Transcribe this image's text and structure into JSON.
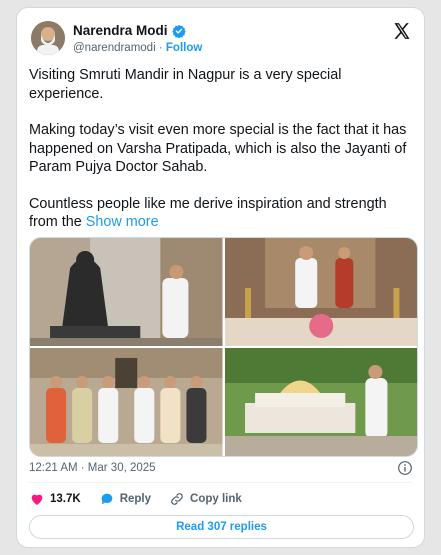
{
  "author": {
    "name": "Narendra Modi",
    "handle": "@narendramodi",
    "separator": "·",
    "follow_label": "Follow"
  },
  "tweet": {
    "paragraph1": "Visiting Smruti Mandir in Nagpur is a very special experience.",
    "paragraph2": "Making today’s visit even more special is the fact that it has happened on Varsha Pratipada, which is also the Jayanti of Param Pujya Doctor Sahab.",
    "paragraph3": "Countless people like me derive inspiration and strength from the",
    "show_more": "Show more",
    "timestamp": "12:21 AM · Mar 30, 2025"
  },
  "actions": {
    "likes": "13.7K",
    "reply_label": "Reply",
    "copy_link_label": "Copy link"
  },
  "read_replies_label": "Read 307 replies",
  "colors": {
    "accent": "#1d9bf0",
    "like": "#f91880",
    "muted": "#536471"
  },
  "icons": [
    "verified-badge-icon",
    "x-logo-icon",
    "info-icon",
    "heart-icon",
    "reply-icon",
    "link-icon"
  ]
}
